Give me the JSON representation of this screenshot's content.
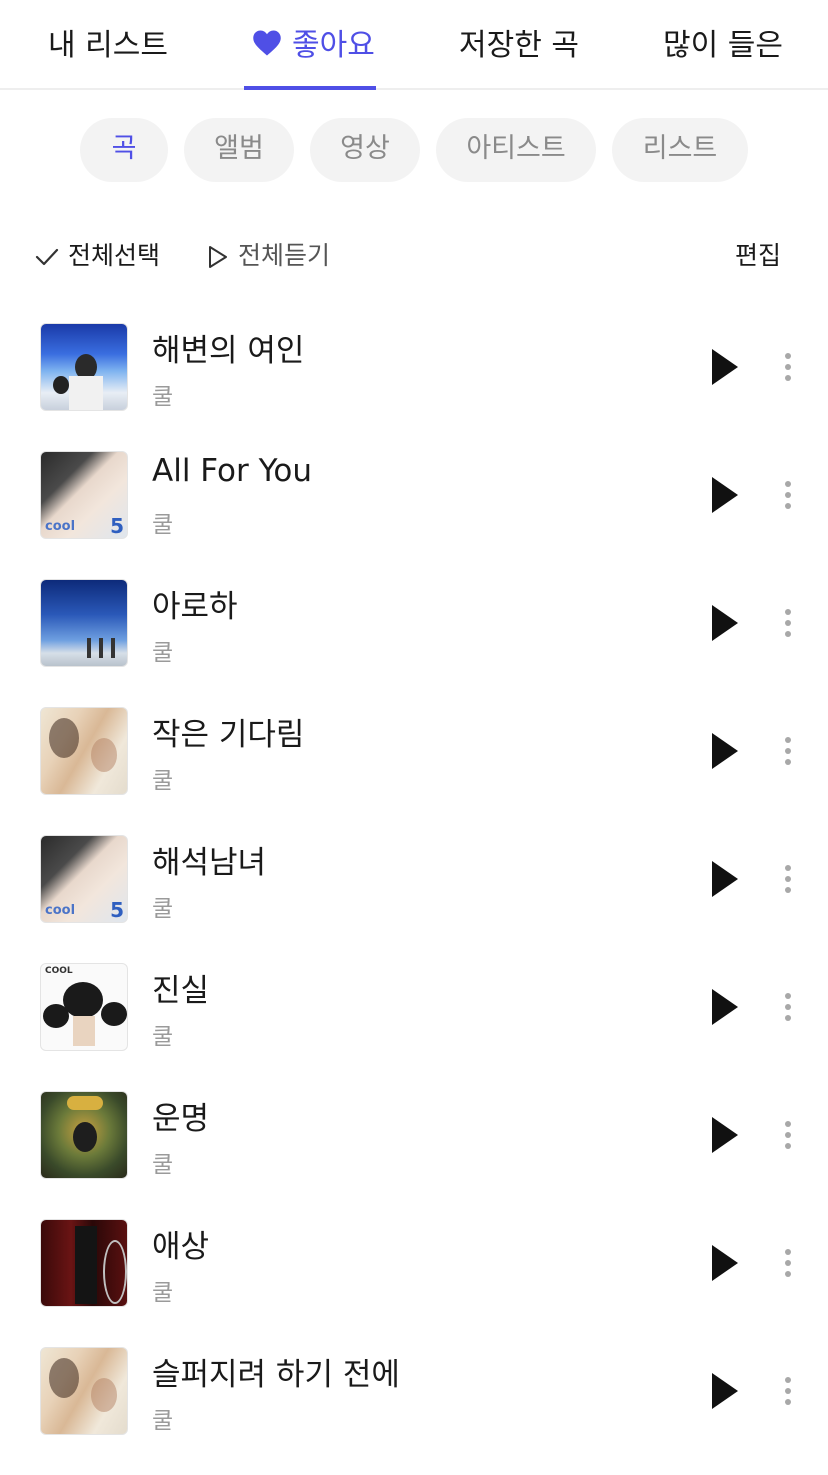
{
  "tabs": [
    {
      "label": "내 리스트",
      "active": false
    },
    {
      "label": "좋아요",
      "active": true,
      "icon": "heart-icon"
    },
    {
      "label": "저장한 곡",
      "active": false
    },
    {
      "label": "많이 들은",
      "active": false
    }
  ],
  "chips": [
    {
      "label": "곡",
      "active": true
    },
    {
      "label": "앨범",
      "active": false
    },
    {
      "label": "영상",
      "active": false
    },
    {
      "label": "아티스트",
      "active": false
    },
    {
      "label": "리스트",
      "active": false
    }
  ],
  "actions": {
    "select_all": "전체선택",
    "play_all": "전체듣기",
    "edit": "편집"
  },
  "songs": [
    {
      "title": "해변의 여인",
      "artist": "쿨"
    },
    {
      "title": "All For You",
      "artist": "쿨"
    },
    {
      "title": "아로하",
      "artist": "쿨"
    },
    {
      "title": "작은 기다림",
      "artist": "쿨"
    },
    {
      "title": "해석남녀",
      "artist": "쿨"
    },
    {
      "title": "진실",
      "artist": "쿨"
    },
    {
      "title": "운명",
      "artist": "쿨"
    },
    {
      "title": "애상",
      "artist": "쿨"
    },
    {
      "title": "슬퍼지려 하기 전에",
      "artist": "쿨"
    }
  ],
  "colors": {
    "accent": "#4f4fe6"
  }
}
